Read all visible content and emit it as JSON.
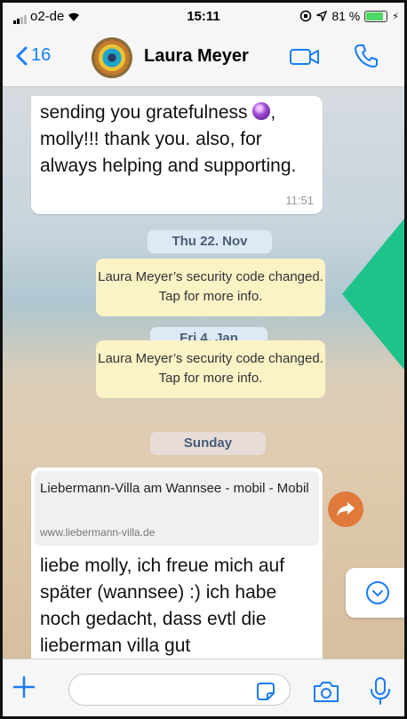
{
  "status_bar": {
    "carrier": "o2-de",
    "time": "15:11",
    "battery": "81 %"
  },
  "header": {
    "back_count": "16",
    "contact_name": "Laura Meyer",
    "icons": [
      "back-chevron-icon",
      "video-call-icon",
      "phone-icon"
    ]
  },
  "messages": {
    "msg1": {
      "text_before": "sending you gratefulness",
      "text_after": ", molly!!! thank you. also, for always helping and supporting.",
      "emoji": "crystal-ball-icon",
      "time": "11:51"
    },
    "date1": "Thu 22. Nov",
    "system1": "Laura Meyer’s security code changed. Tap for more info.",
    "date2": "Fri 4. Jan",
    "system2": "Laura Meyer’s security code changed. Tap for more info.",
    "date3": "Sunday",
    "msg2": {
      "link_title": "Liebermann-Villa am Wannsee - mobil - Mobil",
      "link_domain": "www.liebermann-villa.de",
      "text": "liebe molly, ich freue mich auf später (wannsee) :) ich habe noch gedacht, dass evtl die lieberman villa gut"
    }
  },
  "input_bar": {
    "placeholder": "",
    "icons": [
      "plus-icon",
      "sticker-icon",
      "camera-icon",
      "microphone-icon"
    ]
  },
  "colors": {
    "accent": "#1a7cf3",
    "system_bubble": "#fbf2c6",
    "date_pill": "#dde9f4",
    "share_button": "#e07a3a",
    "overlay_green": "#1ec38a"
  }
}
